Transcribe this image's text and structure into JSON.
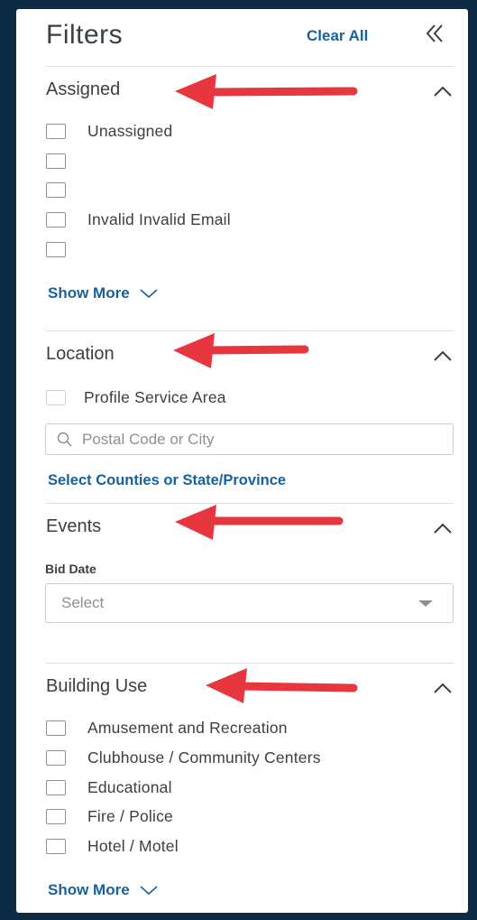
{
  "header": {
    "title": "Filters",
    "clear_all": "Clear All"
  },
  "sections": {
    "assigned": {
      "title": "Assigned",
      "options": [
        "Unassigned",
        "",
        "",
        "Invalid Invalid Email",
        ""
      ],
      "show_more": "Show More"
    },
    "location": {
      "title": "Location",
      "profile_service_area": "Profile Service Area",
      "search_placeholder": "Postal Code or City",
      "counties_link": "Select Counties or State/Province"
    },
    "events": {
      "title": "Events",
      "bid_date_label": "Bid Date",
      "bid_date_select": "Select"
    },
    "building_use": {
      "title": "Building Use",
      "options": [
        "Amusement and Recreation",
        "Clubhouse / Community Centers",
        "Educational",
        "Fire / Police",
        "Hotel / Motel"
      ],
      "show_more": "Show More"
    }
  },
  "colors": {
    "background": "#0d2b45",
    "link": "#17629c",
    "annotation_arrow": "#e8363f",
    "text": "#3a3f44"
  }
}
